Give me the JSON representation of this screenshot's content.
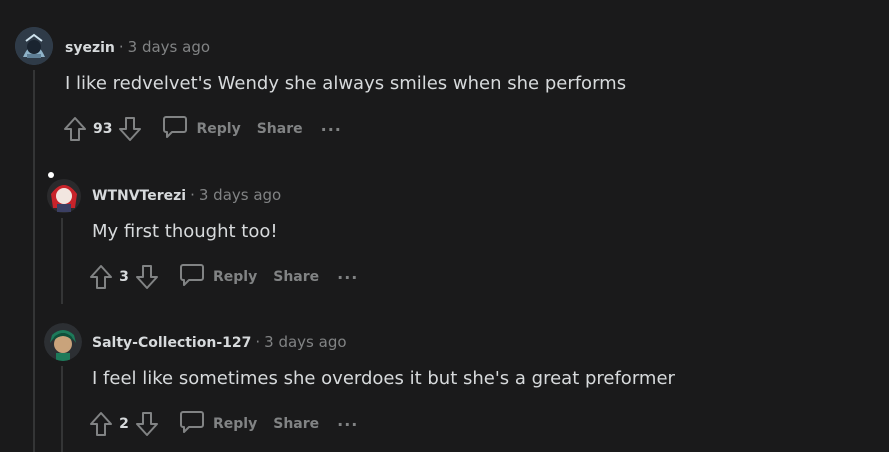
{
  "comments": [
    {
      "author": "syezin",
      "separator": "·",
      "time": "3 days ago",
      "text": "I like redvelvet's Wendy she always smiles when she performs",
      "score": "93",
      "reply_label": "Reply",
      "share_label": "Share",
      "more_label": "···"
    },
    {
      "author": "WTNVTerezi",
      "separator": "·",
      "time": "3 days ago",
      "text": "My first thought too!",
      "score": "3",
      "reply_label": "Reply",
      "share_label": "Share",
      "more_label": "···"
    },
    {
      "author": "Salty-Collection-127",
      "separator": "·",
      "time": "3 days ago",
      "text": "I feel like sometimes she overdoes it but she's a great preformer",
      "score": "2",
      "reply_label": "Reply",
      "share_label": "Share",
      "more_label": "···"
    }
  ],
  "colors": {
    "background": "#1a1a1b",
    "text": "#d7dadc",
    "muted": "#818384",
    "thread_line": "#343536"
  }
}
